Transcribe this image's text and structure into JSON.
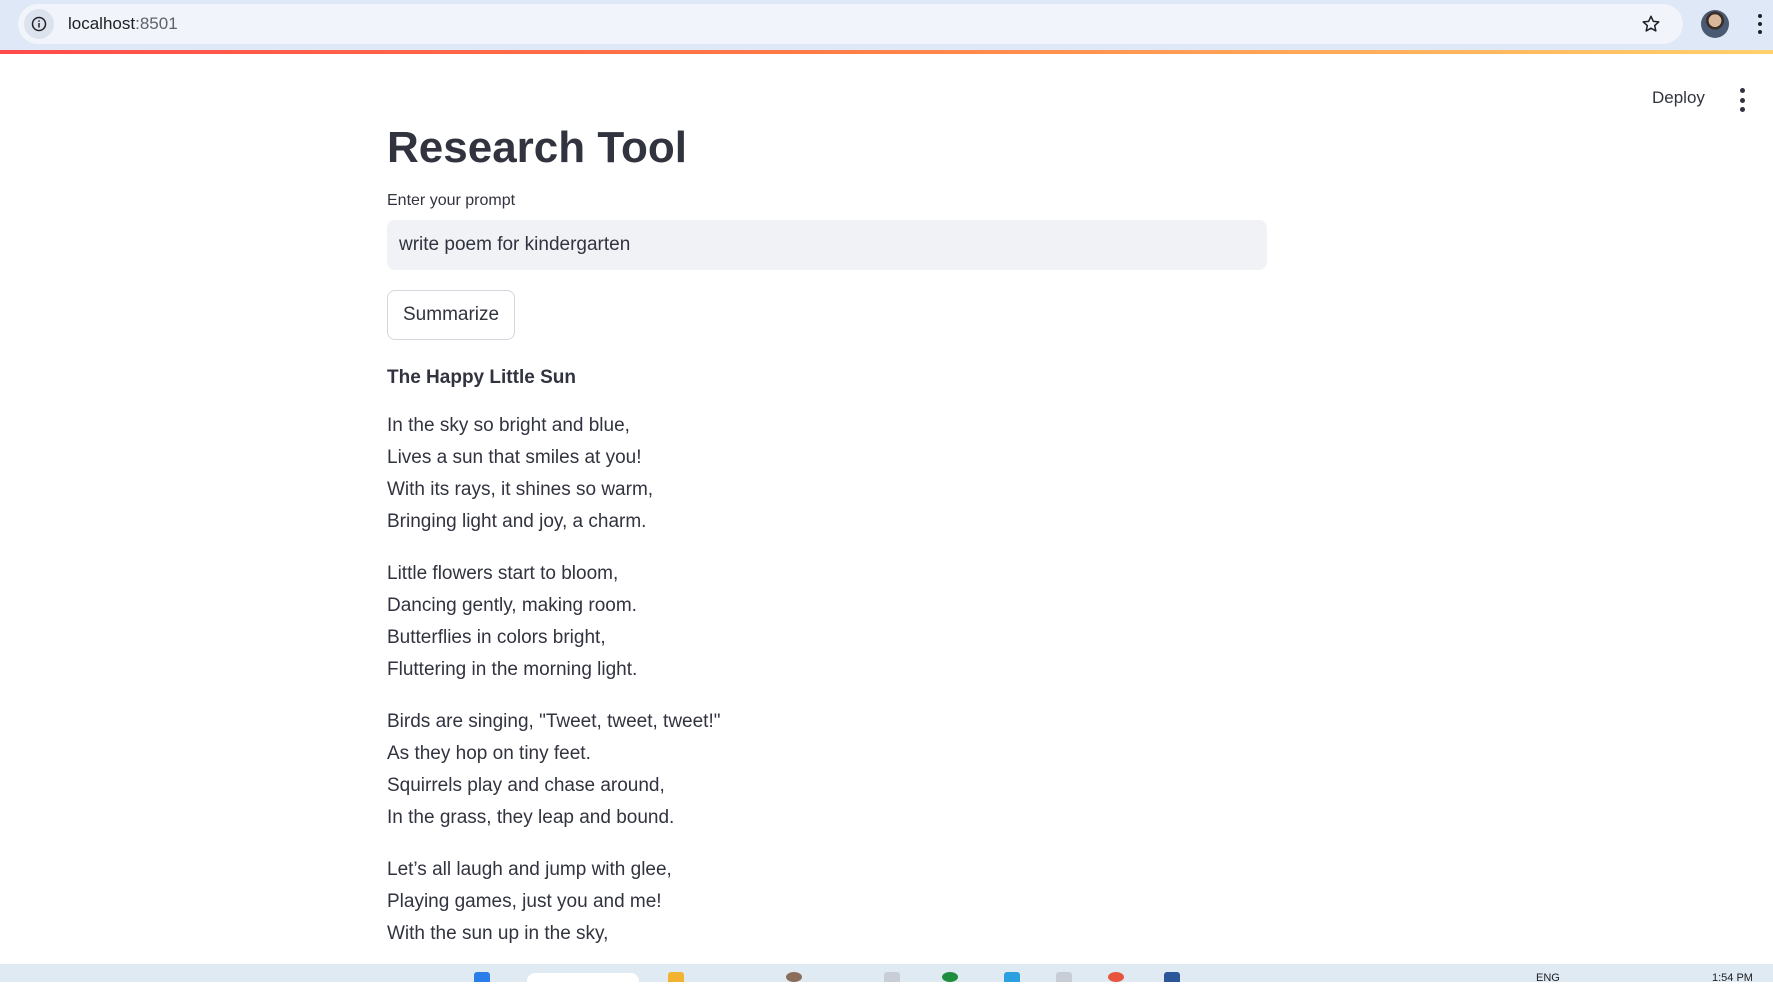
{
  "browser": {
    "url_host": "localhost",
    "url_port": ":8501"
  },
  "toolbar": {
    "deploy_label": "Deploy"
  },
  "app": {
    "title": "Research Tool",
    "prompt_label": "Enter your prompt",
    "prompt_value": "write poem for kindergarten",
    "submit_label": "Summarize"
  },
  "poem": {
    "title": "The Happy Little Sun",
    "stanzas": [
      [
        "In the sky so bright and blue,",
        "Lives a sun that smiles at you!",
        "With its rays, it shines so warm,",
        "Bringing light and joy, a charm."
      ],
      [
        "Little flowers start to bloom,",
        "Dancing gently, making room.",
        "Butterflies in colors bright,",
        "Fluttering in the morning light."
      ],
      [
        "Birds are singing, \"Tweet, tweet, tweet!\"",
        "As they hop on tiny feet.",
        "Squirrels play and chase around,",
        "In the grass, they leap and bound."
      ],
      [
        "Let’s all laugh and jump with glee,",
        "Playing games, just you and me!",
        "With the sun up in the sky,"
      ]
    ]
  },
  "taskbar": {
    "language": "ENG",
    "time": "1:54 PM"
  },
  "colors": {
    "text": "#31333f",
    "input_bg": "#f0f2f6",
    "chrome_bg": "#dfe8f6",
    "accent": "#ff4b4b"
  }
}
